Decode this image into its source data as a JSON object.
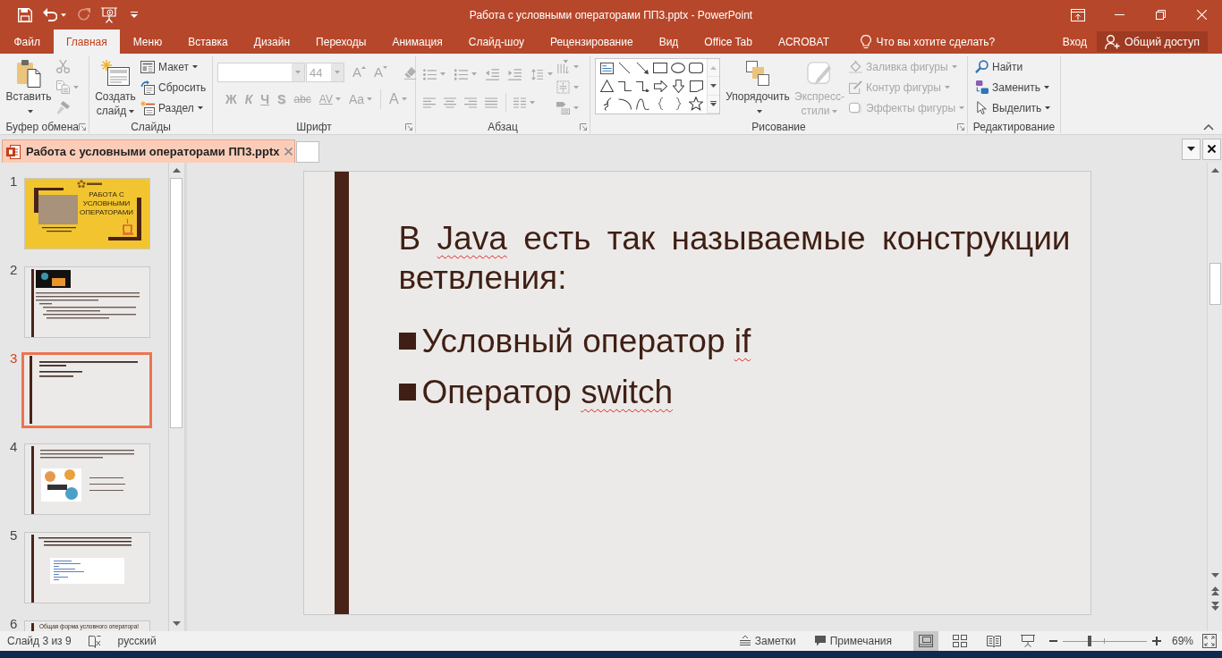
{
  "title_bar": {
    "title": "Работа с условными операторами ПП3.pptx - PowerPoint",
    "quick_access": [
      {
        "kind": "save",
        "caret": false,
        "disabled": false
      },
      {
        "kind": "undo",
        "caret": true,
        "disabled": false
      },
      {
        "kind": "redo",
        "caret": false,
        "disabled": true
      },
      {
        "kind": "slideshow",
        "caret": false,
        "disabled": false
      },
      {
        "kind": "customize",
        "caret": false,
        "disabled": false
      }
    ],
    "window_controls": [
      {
        "kind": "ribbon-options"
      },
      {
        "kind": "minimize"
      },
      {
        "kind": "restore"
      },
      {
        "kind": "close"
      }
    ]
  },
  "ribbon_tabs": [
    {
      "label": "Файл",
      "selected": false
    },
    {
      "label": "Главная",
      "selected": true
    },
    {
      "label": "Меню",
      "selected": false
    },
    {
      "label": "Вставка",
      "selected": false
    },
    {
      "label": "Дизайн",
      "selected": false
    },
    {
      "label": "Переходы",
      "selected": false
    },
    {
      "label": "Анимация",
      "selected": false
    },
    {
      "label": "Слайд-шоу",
      "selected": false
    },
    {
      "label": "Рецензирование",
      "selected": false
    },
    {
      "label": "Вид",
      "selected": false
    },
    {
      "label": "Office Tab",
      "selected": false
    },
    {
      "label": "ACROBAT",
      "selected": false
    }
  ],
  "tell_me": {
    "label": "Что вы хотите сделать?"
  },
  "account": {
    "sign_in": "Вход",
    "share": "Общий доступ"
  },
  "ribbon": {
    "clipboard": {
      "label": "Буфер обмена",
      "launcher": true,
      "paste": {
        "label": "Вставить",
        "caret": true,
        "disabled": false
      },
      "tools": [
        {
          "kind": "cut",
          "caret": false,
          "disabled": true
        },
        {
          "kind": "copy",
          "caret": true,
          "disabled": true
        },
        {
          "kind": "painter",
          "caret": false,
          "disabled": true
        }
      ]
    },
    "slides": {
      "label": "Слайды",
      "launcher": false,
      "new_slide": {
        "label": "Создать слайд",
        "caret": true,
        "disabled": false
      },
      "commands": [
        {
          "kind": "layout",
          "label": "Макет",
          "caret": true,
          "disabled": false
        },
        {
          "kind": "reset",
          "label": "Сбросить",
          "caret": false,
          "disabled": false
        },
        {
          "kind": "section",
          "label": "Раздел",
          "caret": true,
          "disabled": false
        }
      ]
    },
    "font": {
      "label": "Шрифт",
      "launcher": true,
      "font_name": {
        "disabled": true
      },
      "font_size": {
        "value": "44",
        "disabled": true
      },
      "size_buttons": [
        {
          "kind": "grow",
          "label": "A",
          "disabled": true
        },
        {
          "kind": "shrink",
          "label": "A",
          "disabled": true
        }
      ],
      "clear": {
        "disabled": true
      },
      "formats": [
        {
          "kind": "bold",
          "label": "Ж",
          "caret": false,
          "disabled": true
        },
        {
          "kind": "italic",
          "label": "К",
          "caret": false,
          "disabled": true
        },
        {
          "kind": "underline",
          "label": "Ч",
          "caret": false,
          "disabled": true
        },
        {
          "kind": "shadow",
          "label": "S",
          "caret": false,
          "disabled": true
        },
        {
          "kind": "strike",
          "label": "abc",
          "caret": false,
          "disabled": true
        },
        {
          "kind": "spacing",
          "label": "AV",
          "caret": true,
          "disabled": true
        },
        {
          "kind": "case",
          "label": "Aa",
          "caret": true,
          "disabled": true
        },
        {
          "kind": "color",
          "label": "A",
          "caret": true,
          "disabled": true
        }
      ]
    },
    "paragraph": {
      "label": "Абзац",
      "launcher": true,
      "list_buttons": [
        {
          "kind": "bullets",
          "caret": true,
          "disabled": true
        },
        {
          "kind": "numbering",
          "caret": true,
          "disabled": true
        },
        {
          "kind": "outdent",
          "caret": false,
          "disabled": true
        },
        {
          "kind": "indent",
          "caret": false,
          "disabled": true
        },
        {
          "kind": "spacing",
          "caret": true,
          "disabled": true
        }
      ],
      "align_buttons": [
        {
          "kind": "left",
          "caret": false,
          "disabled": true
        },
        {
          "kind": "center",
          "caret": false,
          "disabled": true
        },
        {
          "kind": "right",
          "caret": false,
          "disabled": true
        },
        {
          "kind": "justify",
          "caret": false,
          "disabled": true
        },
        {
          "kind": "columns",
          "caret": true,
          "disabled": true
        }
      ],
      "text_buttons": [
        {
          "kind": "direction",
          "caret": true,
          "disabled": true
        },
        {
          "kind": "align",
          "caret": true,
          "disabled": true
        },
        {
          "kind": "smartart",
          "caret": true,
          "disabled": true
        }
      ]
    },
    "drawing": {
      "label": "Рисование",
      "launcher": true,
      "shapes": [
        {
          "kind": "textbox"
        },
        {
          "kind": "line"
        },
        {
          "kind": "arrow"
        },
        {
          "kind": "rectangle"
        },
        {
          "kind": "oval"
        },
        {
          "kind": "rounded"
        },
        {
          "kind": "triangle"
        },
        {
          "kind": "elbow"
        },
        {
          "kind": "elbow-arrow"
        },
        {
          "kind": "right-arrow"
        },
        {
          "kind": "down-arrow"
        },
        {
          "kind": "flowchart"
        },
        {
          "kind": "freeform"
        },
        {
          "kind": "arc"
        },
        {
          "kind": "curve"
        },
        {
          "kind": "left-brace"
        },
        {
          "kind": "right-brace"
        },
        {
          "kind": "star"
        }
      ],
      "arrange": {
        "label": "Упорядочить",
        "caret": true,
        "disabled": false
      },
      "quick_styles": {
        "label": "Экспресс-стили",
        "caret": true,
        "disabled": true
      },
      "shape_formats": [
        {
          "kind": "fill",
          "label": "Заливка фигуры",
          "caret": true,
          "disabled": true
        },
        {
          "kind": "outline",
          "label": "Контур фигуры",
          "caret": true,
          "disabled": true
        },
        {
          "kind": "effects",
          "label": "Эффекты фигуры",
          "caret": true,
          "disabled": true
        }
      ]
    },
    "editing": {
      "label": "Редактирование",
      "launcher": false,
      "commands": [
        {
          "kind": "find",
          "label": "Найти",
          "caret": false,
          "disabled": false
        },
        {
          "kind": "replace",
          "label": "Заменить",
          "caret": true,
          "disabled": false
        },
        {
          "kind": "select",
          "label": "Выделить",
          "caret": true,
          "disabled": false
        }
      ]
    }
  },
  "document_tabs": [
    {
      "label": "Работа с условными операторами ПП3.pptx",
      "selected": true
    }
  ],
  "slides_pane": {
    "slides": [
      {
        "number": "1",
        "kind": "title",
        "title": "РАБОТА С УСЛОВНЫМИ ОПЕРАТОРАМИ",
        "selected": false
      },
      {
        "number": "2",
        "kind": "image-text",
        "selected": false
      },
      {
        "number": "3",
        "kind": "text",
        "selected": true
      },
      {
        "number": "4",
        "kind": "illustration",
        "selected": false
      },
      {
        "number": "5",
        "kind": "code",
        "selected": false
      },
      {
        "number": "6",
        "kind": "heading",
        "title": "Общая форма условного оператора!",
        "selected": false
      }
    ]
  },
  "slide": {
    "title": [
      {
        "text": "В ",
        "misspelled": false
      },
      {
        "text": "Java",
        "misspelled": true
      },
      {
        "text": " есть так называемые конструкции ветвления:",
        "misspelled": false
      }
    ],
    "bullets": [
      [
        {
          "text": "Условный оператор ",
          "misspelled": false
        },
        {
          "text": "if",
          "misspelled": true
        }
      ],
      [
        {
          "text": "Оператор ",
          "misspelled": false
        },
        {
          "text": "switch",
          "misspelled": true
        }
      ]
    ]
  },
  "status_bar": {
    "slide_info": "Слайд 3 из 9",
    "language": "русский",
    "notes": "Заметки",
    "comments": "Примечания",
    "views": [
      {
        "kind": "normal",
        "selected": true
      },
      {
        "kind": "sorter",
        "selected": false
      },
      {
        "kind": "reading",
        "selected": false
      },
      {
        "kind": "slideshow",
        "selected": false
      }
    ],
    "zoom": {
      "level": 0.32,
      "reading": "69%"
    }
  }
}
